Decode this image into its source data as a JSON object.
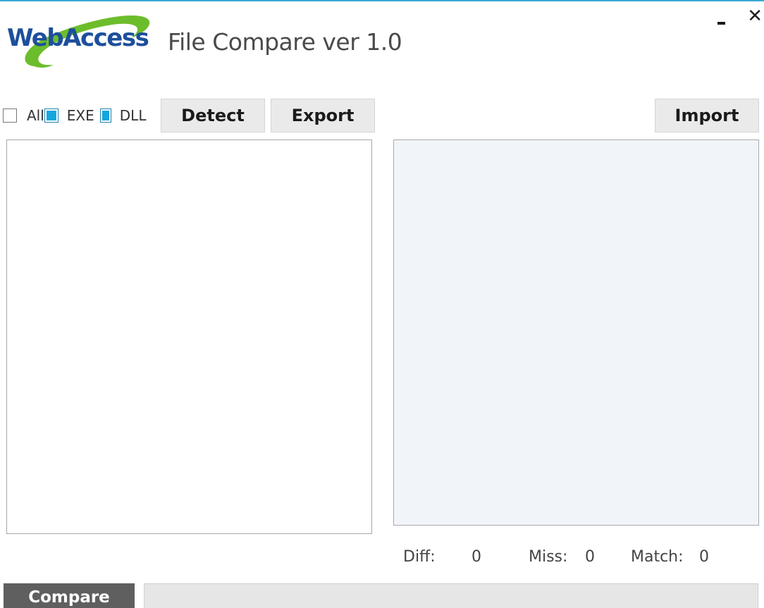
{
  "window": {
    "title": "File Compare ver 1.0",
    "logo_text": "WebAccess",
    "minimize_icon": "minimize-icon",
    "close_icon": "close-icon",
    "close_glyph": "✕"
  },
  "filters": {
    "all": {
      "label": "All",
      "checked": false
    },
    "exe": {
      "label": "EXE",
      "checked": true
    },
    "dll": {
      "label": "DLL",
      "checked": true
    }
  },
  "toolbar": {
    "detect_label": "Detect",
    "export_label": "Export",
    "import_label": "Import"
  },
  "lists": {
    "left_items": [],
    "right_items": []
  },
  "stats": {
    "diff_label": "Diff:",
    "diff_value": "0",
    "miss_label": "Miss:",
    "miss_value": "0",
    "match_label": "Match:",
    "match_value": "0"
  },
  "footer": {
    "compare_label": "Compare",
    "progress_percent": 0
  },
  "colors": {
    "accent": "#16a6dc",
    "logo_blue": "#1d4f9c",
    "logo_green": "#6cbd2c",
    "compare_button": "#5f5f5f",
    "right_list_bg": "#f1f5fa"
  }
}
